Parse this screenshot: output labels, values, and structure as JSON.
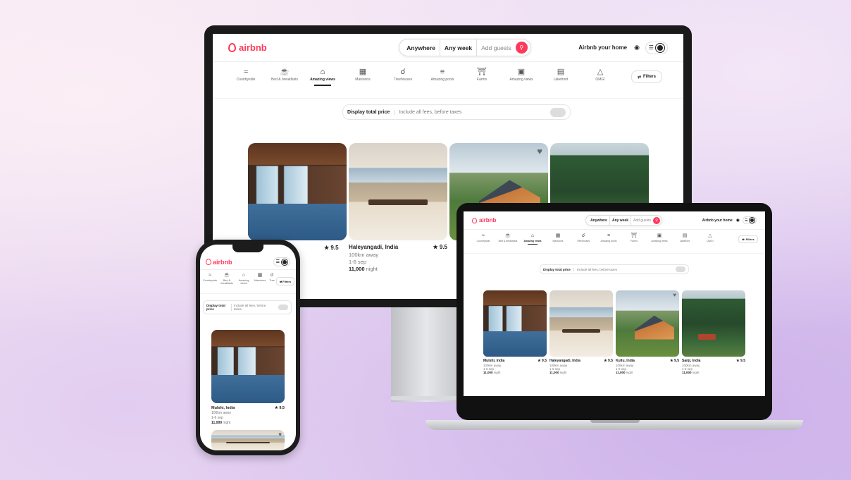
{
  "brand": {
    "name": "airbnb",
    "accent": "#ff385c"
  },
  "search": {
    "where": "Anywhere",
    "when": "Any week",
    "guests": "Add guests"
  },
  "header": {
    "host_label": "Airbnb your home"
  },
  "categories": [
    {
      "label": "Countryside",
      "icon": "countryside-icon"
    },
    {
      "label": "Bed & breakfasts",
      "icon": "bed-breakfast-icon"
    },
    {
      "label": "Amazing views",
      "icon": "amazing-views-icon",
      "active": true
    },
    {
      "label": "Mansions",
      "icon": "mansions-icon"
    },
    {
      "label": "Treehouses",
      "icon": "treehouses-icon"
    },
    {
      "label": "Amazing pools",
      "icon": "pools-icon"
    },
    {
      "label": "Farms",
      "icon": "farms-icon"
    },
    {
      "label": "Amazing views",
      "icon": "amazing-views-icon"
    },
    {
      "label": "Lakefront",
      "icon": "lakefront-icon"
    },
    {
      "label": "OMG!",
      "icon": "omg-icon"
    }
  ],
  "phone_categories": [
    {
      "label": "Countryside"
    },
    {
      "label": "Bed & breakfasts"
    },
    {
      "label": "Amazing views"
    },
    {
      "label": "Mansions"
    },
    {
      "label": "Tree"
    }
  ],
  "filters_label": "Filters",
  "price_toggle": {
    "label": "Display total price",
    "sub": "Include all fees, before taxes"
  },
  "phone_price_toggle": {
    "label": "Display total price",
    "sub": "Include all fees, before taxes"
  },
  "listings": [
    {
      "title": "Mulshi, India",
      "rating": "9.5",
      "distance": "100km away",
      "dates": "1-6 sep",
      "price": "11,000",
      "unit": "night"
    },
    {
      "title": "Haleyangadi, India",
      "rating": "9.5",
      "distance": "100km away",
      "dates": "1-6 sep",
      "price": "11,000",
      "unit": "night"
    },
    {
      "title": "Kullu, India",
      "rating": "9.5",
      "distance": "100km away",
      "dates": "1-6 sep",
      "price": "11,000",
      "unit": "night"
    },
    {
      "title": "Sanji, India",
      "rating": "9.5",
      "distance": "100km away",
      "dates": "1-6 sep",
      "price": "11,000",
      "unit": "night"
    }
  ]
}
